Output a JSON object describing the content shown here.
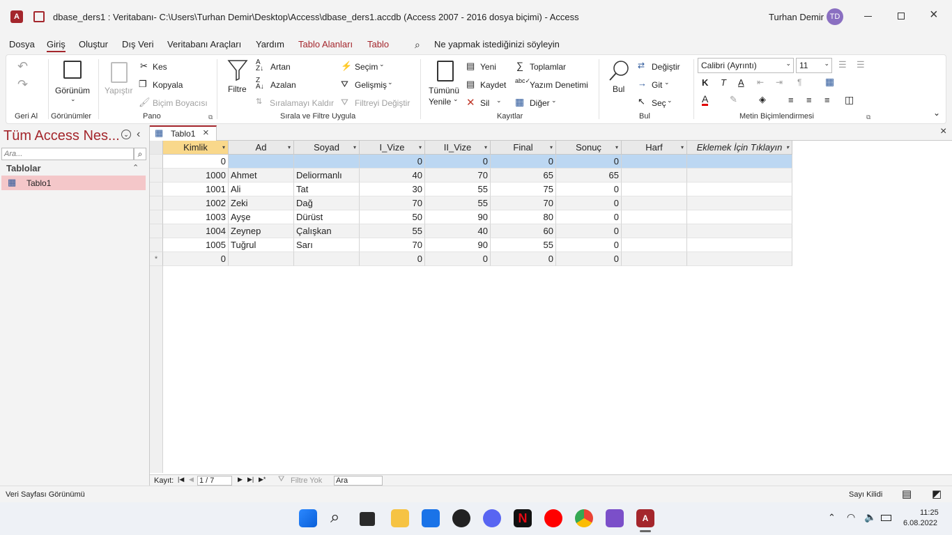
{
  "titlebar": {
    "title": "dbase_ders1 : Veritabanı- C:\\Users\\Turhan Demir\\Desktop\\Access\\dbase_ders1.accdb (Access 2007 - 2016 dosya biçimi)  -  Access",
    "user_name": "Turhan Demir",
    "user_initials": "TD"
  },
  "menu": {
    "items": [
      "Dosya",
      "Giriş",
      "Oluştur",
      "Dış Veri",
      "Veritabanı Araçları",
      "Yardım",
      "Tablo Alanları",
      "Tablo"
    ],
    "tell_me": "Ne yapmak istediğinizi söyleyin"
  },
  "ribbon": {
    "undo_group": "Geri Al",
    "views_group": "Görünümler",
    "view_label": "Görünüm",
    "clipboard_group": "Pano",
    "paste": "Yapıştır",
    "cut": "Kes",
    "copy": "Kopyala",
    "format_painter": "Biçim Boyacısı",
    "sort_group": "Sırala ve Filtre Uygula",
    "filter": "Filtre",
    "ascending": "Artan",
    "descending": "Azalan",
    "remove_sort": "Sıralamayı Kaldır",
    "selection": "Seçim",
    "advanced": "Gelişmiş",
    "toggle_filter": "Filtreyi Değiştir",
    "records_group": "Kayıtlar",
    "refresh_all_1": "Tümünü",
    "refresh_all_2": "Yenile",
    "new": "Yeni",
    "save": "Kaydet",
    "delete": "Sil",
    "totals": "Toplamlar",
    "spelling": "Yazım Denetimi",
    "more": "Diğer",
    "find_group": "Bul",
    "find": "Bul",
    "replace": "Değiştir",
    "goto": "Git",
    "select": "Seç",
    "format_group": "Metin Biçimlendirmesi",
    "font": "Calibri (Ayrıntı)",
    "font_size": "11",
    "bold": "K",
    "italic": "T",
    "underline": "A"
  },
  "nav": {
    "title": "Tüm Access Nes...",
    "search_placeholder": "Ara...",
    "section": "Tablolar",
    "items": [
      "Tablo1"
    ]
  },
  "tab": {
    "name": "Tablo1"
  },
  "table": {
    "columns": [
      "Kimlik",
      "Ad",
      "Soyad",
      "I_Vize",
      "II_Vize",
      "Final",
      "Sonuç",
      "Harf",
      "Eklemek İçin Tıklayın"
    ],
    "default_row": [
      "0",
      "",
      "",
      "0",
      "0",
      "0",
      "0",
      ""
    ],
    "rows": [
      [
        "1000",
        "Ahmet",
        "Deliormanlı",
        "40",
        "70",
        "65",
        "65",
        ""
      ],
      [
        "1001",
        "Ali",
        "Tat",
        "30",
        "55",
        "75",
        "0",
        ""
      ],
      [
        "1002",
        "Zeki",
        "Dağ",
        "70",
        "55",
        "70",
        "0",
        ""
      ],
      [
        "1003",
        "Ayşe",
        "Dürüst",
        "50",
        "90",
        "80",
        "0",
        ""
      ],
      [
        "1004",
        "Zeynep",
        "Çalışkan",
        "55",
        "40",
        "60",
        "0",
        ""
      ],
      [
        "1005",
        "Tuğrul",
        "Sarı",
        "70",
        "90",
        "55",
        "0",
        ""
      ]
    ],
    "new_row": [
      "0",
      "",
      "",
      "0",
      "0",
      "0",
      "0",
      ""
    ]
  },
  "recordnav": {
    "label": "Kayıt:",
    "position": "1 / 7",
    "filter": "Filtre Yok",
    "search": "Ara"
  },
  "status": {
    "view": "Veri Sayfası Görünümü",
    "numlock": "Sayı Kilidi"
  },
  "clock": {
    "time": "11:25",
    "date": "6.08.2022"
  }
}
